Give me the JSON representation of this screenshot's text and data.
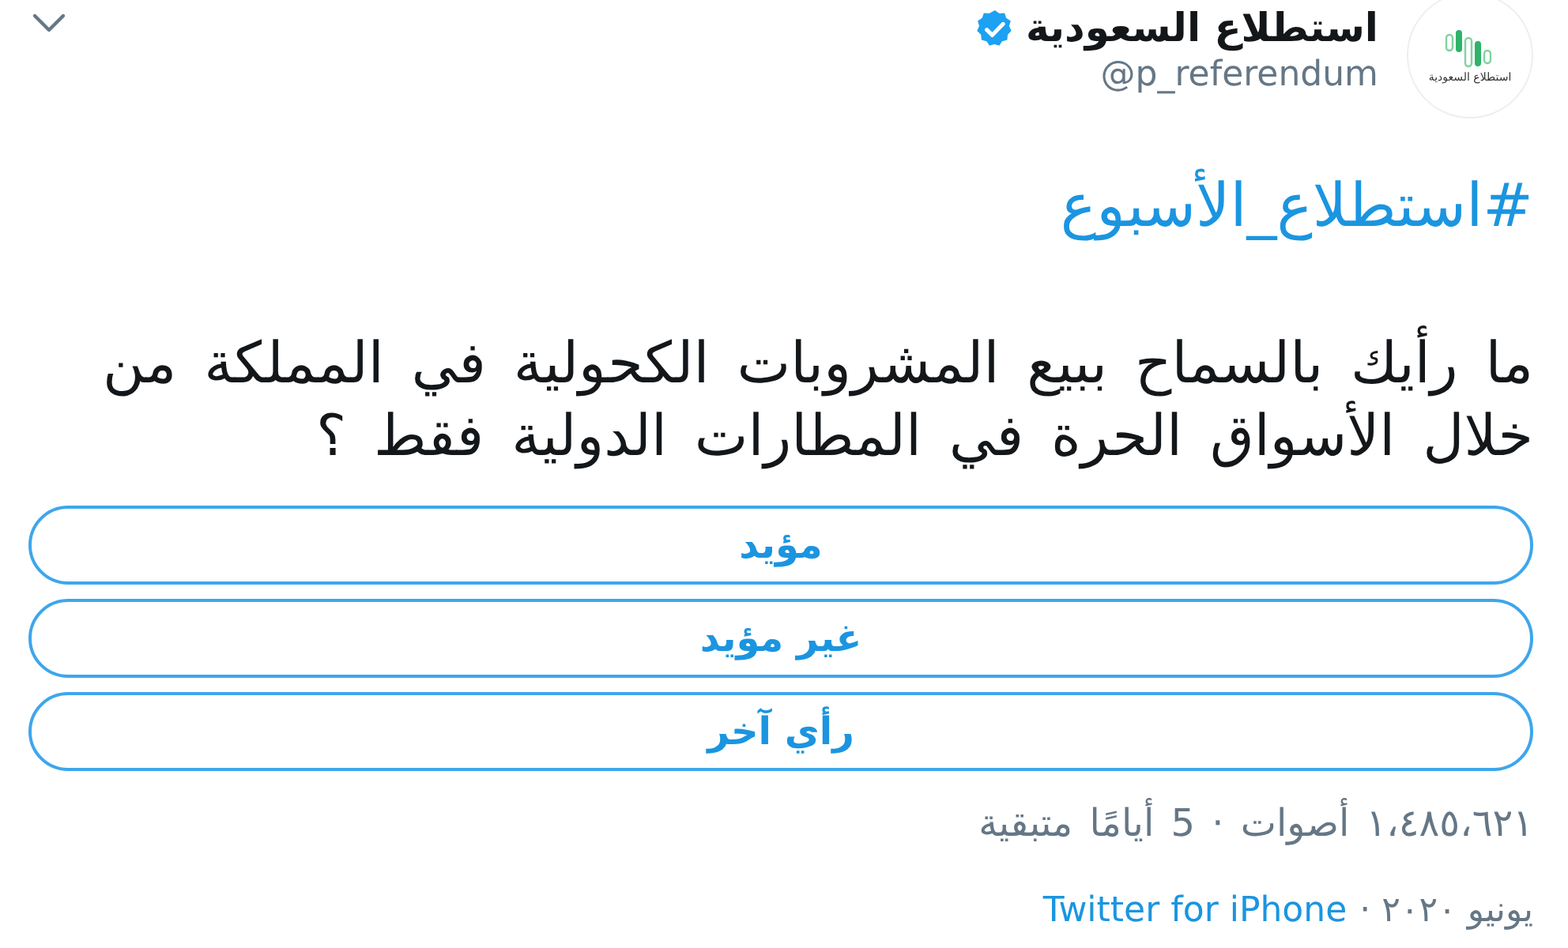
{
  "header": {
    "display_name": "استطلاع السعودية",
    "verified": true,
    "handle": "@p_referendum",
    "avatar_logo_text": "استطلاع السعودية"
  },
  "tweet": {
    "hashtag": "#استطلاع_الأسبوع",
    "question_lines": [
      "ما رأيك بالسماح ببيع المشروبات الكحولية في المملكة من",
      "خلال الأسواق الحرة في المطارات الدولية فقط ؟"
    ]
  },
  "poll": {
    "options": [
      {
        "label": "مؤيد"
      },
      {
        "label": "غير مؤيد"
      },
      {
        "label": "رأي آخر"
      }
    ],
    "summary": "١،٤٨٥،٦٢١ أصوات · 5 أيامًا متبقية"
  },
  "footer": {
    "timestamp": "يونيو ٢٠٢٠ ·",
    "source_app": "Twitter for iPhone"
  }
}
